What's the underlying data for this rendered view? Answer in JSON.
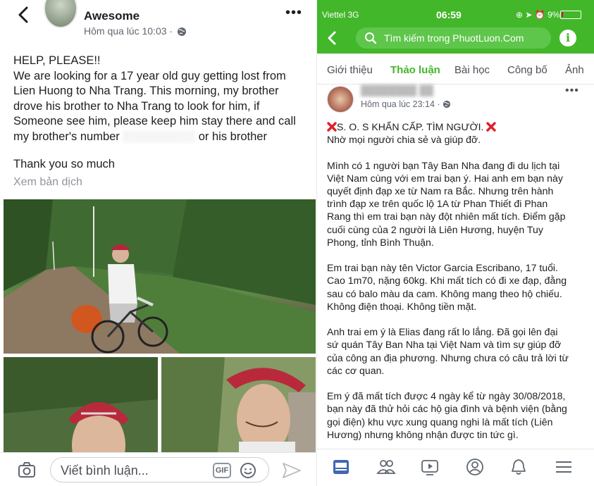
{
  "left": {
    "author": "Awesome",
    "timestamp": "Hôm qua lúc 10:03 ·",
    "post_lines": [
      "HELP, PLEASE!!",
      "We are looking for a 17 year old guy getting lost from",
      "Lien Huong to Nha Trang. This morning, my brother",
      "drove his brother to Nha Trang to look for him, if",
      "Someone see him, please keep him stay there and call"
    ],
    "number_line_before": "my brother's number",
    "number_redacted": "X 0000000 27",
    "number_line_after": " or his brother",
    "thanks": "Thank you so much",
    "translate": "Xem bản dịch",
    "comment_placeholder": "Viết bình luận...",
    "gif_label": "GIF"
  },
  "right": {
    "status": {
      "carrier": "Viettel  3G",
      "time": "06:59",
      "battery": "9%"
    },
    "search_placeholder": "Tìm kiếm trong PhuotLuon.Com",
    "info_label": "i",
    "tabs": [
      {
        "label": "Giới thiệu",
        "active": false
      },
      {
        "label": "Thảo luận",
        "active": true
      },
      {
        "label": "Bài học",
        "active": false
      },
      {
        "label": "Công bố",
        "active": false
      },
      {
        "label": "Ảnh",
        "active": false
      }
    ],
    "timestamp": "Hôm qua lúc 23:14 ·",
    "headline": "S. O. S KHẨN CẤP. TÌM NGƯỜI.",
    "headline_sub": "Nhờ mọi người chia sẻ và giúp đỡ.",
    "paragraphs": [
      "Mình có 1 người bạn Tây Ban Nha đang đi du lịch tại\nViệt Nam cùng với em trai bạn ý. Hai anh em bạn này\nquyết định đạp xe từ Nam ra Bắc. Nhưng trên hành\ntrình đạp xe trên quốc lộ 1A từ Phan Thiết đi Phan\nRang thì em trai bạn này đột nhiên mất tích. Điểm gặp\ncuối cùng của 2 người là Liên Hương, huyện Tuy\nPhong, tỉnh Bình Thuận.",
      "Em trai bạn này tên Victor Garcia Escribano, 17 tuổi.\nCao 1m70, nặng 60kg. Khi mất tích có đi xe đạp, đằng\nsau có balo màu da cam. Không mang theo hộ chiếu.\nKhông điện thoại. Không tiền mặt.",
      "Anh trai em ý là Elias đang rất lo lắng. Đã gọi lên đại\nsứ quán Tây Ban Nha tại Việt Nam và tìm sự giúp đỡ\ncủa công an địa phương. Nhưng chưa có câu trả lời từ\ncác cơ quan.",
      "Em ý đã mất tích được 4 ngày kể từ ngày 30/08/2018,\nbạn này đã thử hỏi các hộ gia đình và bệnh viện (bằng\ngọi điện) khu vực xung quang nghi là mất tích (Liên\nHương) nhưng không nhận được tin tức gì."
    ]
  },
  "colors": {
    "brand_green": "#42b72a",
    "text": "#1c1e21",
    "muted": "#90949c",
    "red_x": "#e0202a"
  }
}
